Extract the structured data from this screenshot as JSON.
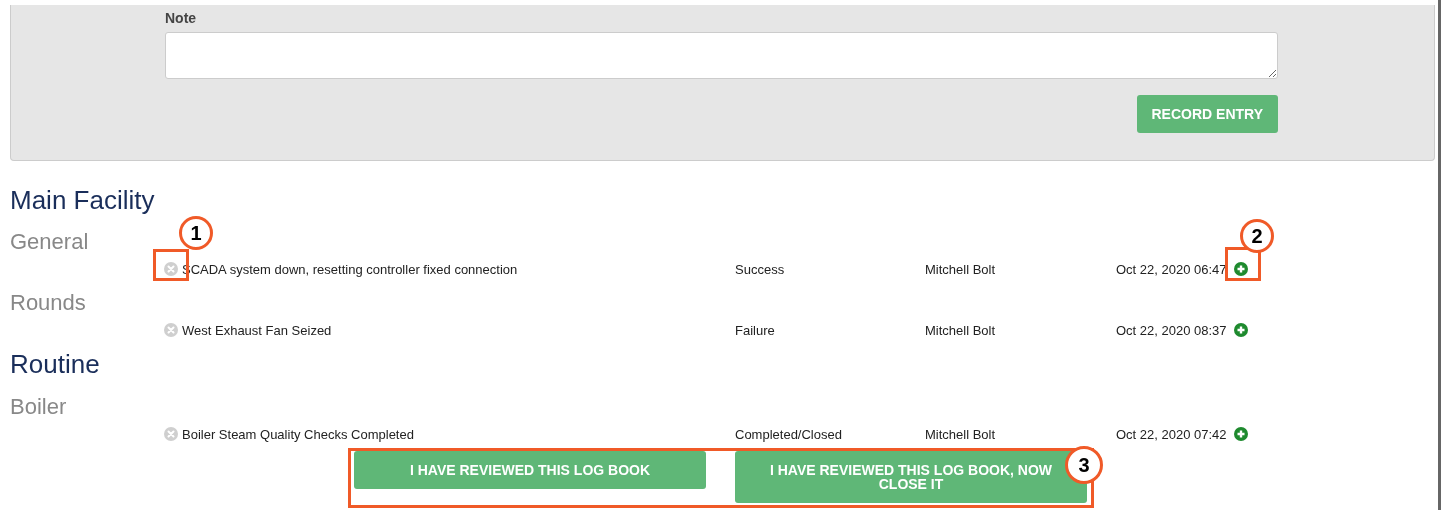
{
  "note_form": {
    "label": "Note",
    "record_button": "RECORD ENTRY"
  },
  "sections": [
    {
      "title": "Main Facility",
      "groups": [
        {
          "name": "General",
          "entries": [
            {
              "text": "SCADA system down, resetting controller fixed connection",
              "status": "Success",
              "user": "Mitchell Bolt",
              "time": "Oct 22, 2020 06:47",
              "remove_callout": "1",
              "add_callout": "2"
            }
          ]
        },
        {
          "name": "Rounds",
          "entries": [
            {
              "text": "West Exhaust Fan Seized",
              "status": "Failure",
              "user": "Mitchell Bolt",
              "time": "Oct 22, 2020 08:37"
            }
          ]
        }
      ]
    },
    {
      "title": "Routine",
      "groups": [
        {
          "name": "Boiler",
          "entries": [
            {
              "text": "Boiler Steam Quality Checks Completed",
              "status": "Completed/Closed",
              "user": "Mitchell Bolt",
              "time": "Oct 22, 2020 07:42"
            }
          ]
        }
      ]
    }
  ],
  "footer": {
    "callout": "3",
    "buttons": [
      "I HAVE REVIEWED THIS LOG BOOK",
      "I HAVE REVIEWED THIS LOG BOOK, NOW CLOSE IT"
    ]
  }
}
